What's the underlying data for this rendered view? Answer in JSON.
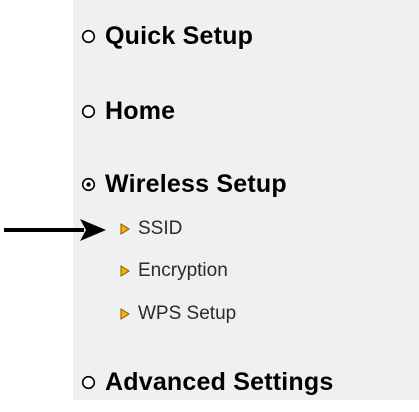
{
  "menu": {
    "items": [
      {
        "label": "Quick Setup",
        "selected": false
      },
      {
        "label": "Home",
        "selected": false
      },
      {
        "label": "Wireless Setup",
        "selected": true
      },
      {
        "label": "Advanced Settings",
        "selected": false
      }
    ],
    "submenu": [
      {
        "label": "SSID"
      },
      {
        "label": "Encryption"
      },
      {
        "label": "WPS Setup"
      }
    ]
  },
  "colors": {
    "panel_bg": "#f0f0f0",
    "bullet_fill": "#f5b400",
    "bullet_stroke": "#8a5a00",
    "arrow": "#000000"
  }
}
